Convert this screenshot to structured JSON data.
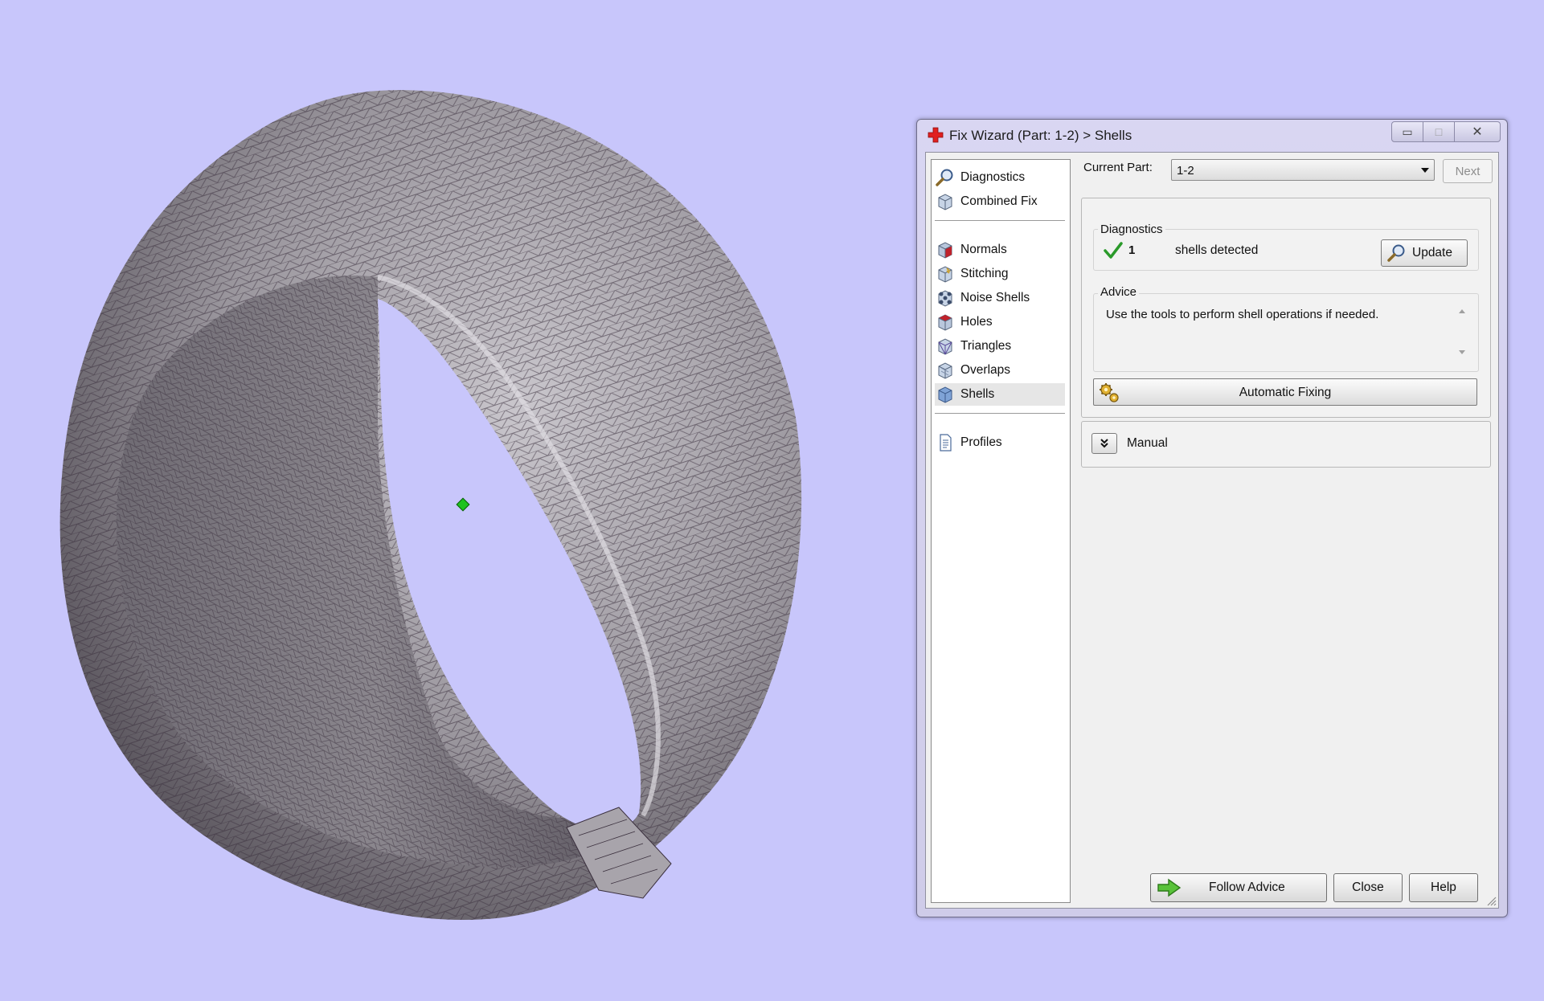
{
  "window": {
    "title": "Fix Wizard (Part: 1-2) > Shells",
    "minimize_glyph": "▭",
    "maximize_glyph": "□",
    "close_glyph": "✕"
  },
  "nav": {
    "items": [
      {
        "label": "Diagnostics",
        "icon": "magnifier-icon"
      },
      {
        "label": "Combined Fix",
        "icon": "cube-icon"
      },
      {
        "label": "Normals",
        "icon": "normals-cube-icon"
      },
      {
        "label": "Stitching",
        "icon": "stitching-cube-icon"
      },
      {
        "label": "Noise Shells",
        "icon": "noise-shells-icon"
      },
      {
        "label": "Holes",
        "icon": "holes-cube-icon"
      },
      {
        "label": "Triangles",
        "icon": "triangles-cube-icon"
      },
      {
        "label": "Overlaps",
        "icon": "overlaps-cube-icon"
      },
      {
        "label": "Shells",
        "icon": "shells-cube-icon"
      },
      {
        "label": "Profiles",
        "icon": "document-icon"
      }
    ],
    "selected": "Shells"
  },
  "header": {
    "current_part_label": "Current Part:",
    "current_part_value": "1-2",
    "next_label": "Next"
  },
  "diagnostics": {
    "title": "Diagnostics",
    "count": "1",
    "text": "shells detected",
    "update_label": "Update"
  },
  "advice": {
    "title": "Advice",
    "text": "Use the tools to perform shell operations if needed."
  },
  "automatic_fixing_label": "Automatic Fixing",
  "manual_label": "Manual",
  "footer": {
    "follow_advice_label": "Follow Advice",
    "close_label": "Close",
    "help_label": "Help"
  },
  "colors": {
    "viewport_background": "#c8c6fb",
    "mesh_fill": "#8e8a90",
    "mesh_lines": "#3a2f3d",
    "pivot": "#1fc21f",
    "close_cross": "#e02020",
    "check": "#2a9a2a"
  }
}
